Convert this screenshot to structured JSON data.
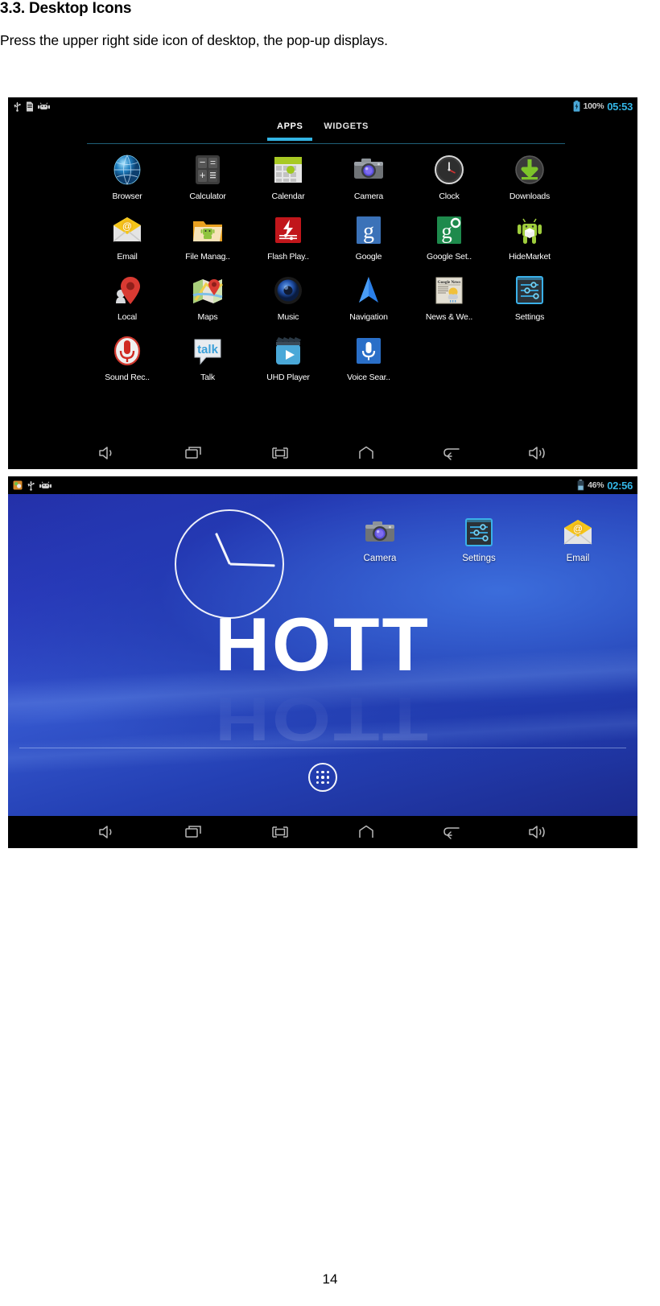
{
  "document": {
    "heading": "3.3. Desktop Icons",
    "paragraph": "Press the upper right side icon of desktop, the pop-up displays.",
    "page_number": "14"
  },
  "colors": {
    "accent_cyan": "#33b5e5",
    "status_text": "#cfcfcf",
    "screen_black": "#000000",
    "wallpaper_blue": "#2b3bbe",
    "label_white": "#ffffff"
  },
  "drawer_screenshot": {
    "status_bar": {
      "left_icons": [
        "usb-icon",
        "sd-card-icon",
        "android-robot-icon"
      ],
      "battery_level": "100%",
      "battery_state": "charging",
      "time": "05:53"
    },
    "tabs": [
      {
        "label": "APPS",
        "active": true
      },
      {
        "label": "WIDGETS",
        "active": false
      }
    ],
    "apps": [
      {
        "label": "Browser",
        "icon": "browser-globe-icon"
      },
      {
        "label": "Calculator",
        "icon": "calculator-icon"
      },
      {
        "label": "Calendar",
        "icon": "calendar-icon"
      },
      {
        "label": "Camera",
        "icon": "camera-icon"
      },
      {
        "label": "Clock",
        "icon": "clock-icon"
      },
      {
        "label": "Downloads",
        "icon": "downloads-arrow-icon"
      },
      {
        "label": "Email",
        "icon": "email-envelope-icon"
      },
      {
        "label": "File Manag..",
        "icon": "file-manager-folder-icon"
      },
      {
        "label": "Flash Play..",
        "icon": "flash-player-icon"
      },
      {
        "label": "Google",
        "icon": "google-g-icon"
      },
      {
        "label": "Google Set..",
        "icon": "google-settings-icon"
      },
      {
        "label": "HideMarket",
        "icon": "android-market-icon"
      },
      {
        "label": "Local",
        "icon": "local-pin-icon"
      },
      {
        "label": "Maps",
        "icon": "maps-icon"
      },
      {
        "label": "Music",
        "icon": "music-speaker-icon"
      },
      {
        "label": "Navigation",
        "icon": "navigation-arrow-icon"
      },
      {
        "label": "News & We..",
        "icon": "news-weather-icon"
      },
      {
        "label": "Settings",
        "icon": "settings-sliders-icon"
      },
      {
        "label": "Sound Rec..",
        "icon": "sound-recorder-mic-icon"
      },
      {
        "label": "Talk",
        "icon": "talk-bubble-icon"
      },
      {
        "label": "UHD Player",
        "icon": "uhd-player-icon"
      },
      {
        "label": "Voice Sear..",
        "icon": "voice-search-mic-icon"
      }
    ],
    "nav_buttons": [
      {
        "name": "volume-down-icon"
      },
      {
        "name": "recent-apps-icon"
      },
      {
        "name": "screenshot-icon"
      },
      {
        "name": "home-icon"
      },
      {
        "name": "back-icon"
      },
      {
        "name": "volume-up-icon"
      }
    ]
  },
  "home_screenshot": {
    "status_bar": {
      "left_icons": [
        "screenshot-capture-icon",
        "usb-icon",
        "android-robot-icon"
      ],
      "battery_level": "46%",
      "battery_state": "discharging",
      "time": "02:56"
    },
    "wallpaper_text": "HOTT",
    "shortcuts": [
      {
        "label": "Camera",
        "icon": "camera-icon"
      },
      {
        "label": "Settings",
        "icon": "settings-sliders-icon"
      },
      {
        "label": "Email",
        "icon": "email-envelope-icon"
      }
    ],
    "app_drawer_button": "app-drawer-grid-icon",
    "nav_buttons": [
      {
        "name": "volume-down-icon"
      },
      {
        "name": "recent-apps-icon"
      },
      {
        "name": "screenshot-icon"
      },
      {
        "name": "home-icon"
      },
      {
        "name": "back-icon"
      },
      {
        "name": "volume-up-icon"
      }
    ]
  }
}
